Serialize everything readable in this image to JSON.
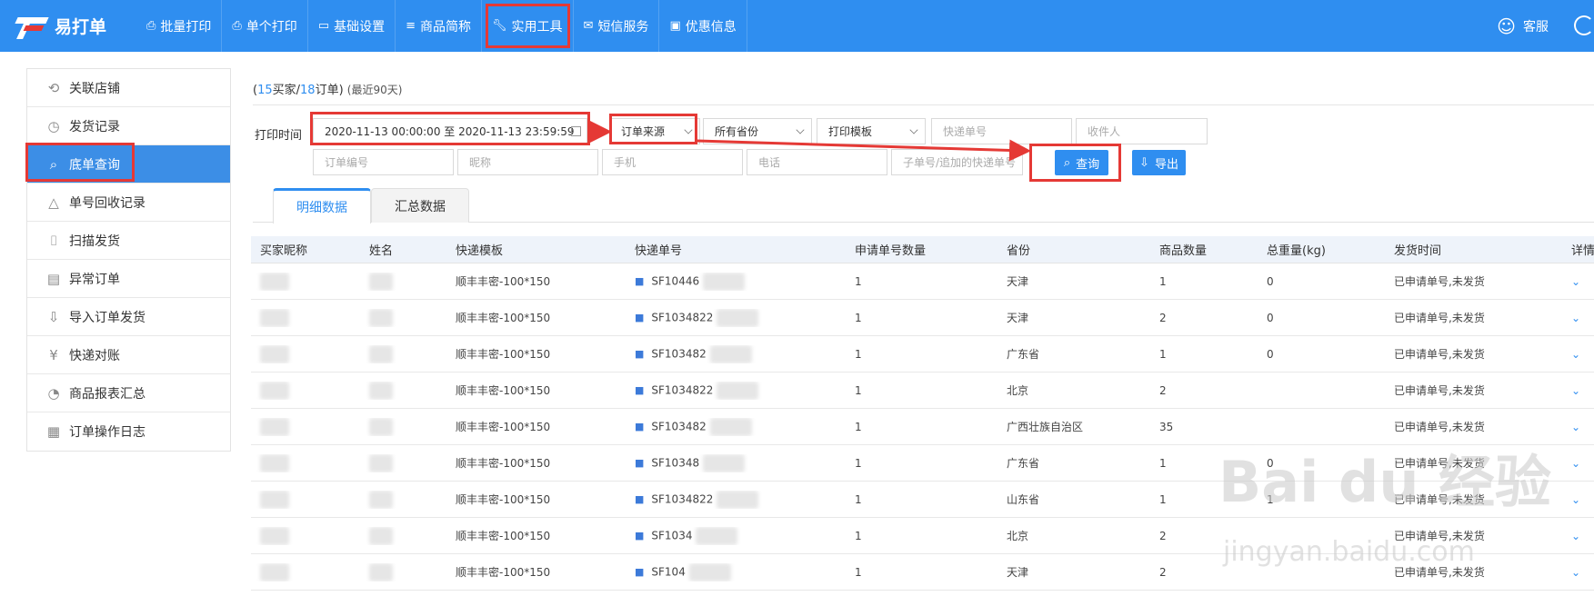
{
  "app": {
    "name": "易打单"
  },
  "nav": [
    {
      "icon": "printer-icon",
      "label": "批量打印"
    },
    {
      "icon": "printer-icon",
      "label": "单个打印"
    },
    {
      "icon": "monitor-icon",
      "label": "基础设置"
    },
    {
      "icon": "list-icon",
      "label": "商品简称"
    },
    {
      "icon": "wrench-icon",
      "label": "实用工具"
    },
    {
      "icon": "mail-icon",
      "label": "短信服务"
    },
    {
      "icon": "ticket-icon",
      "label": "优惠信息"
    }
  ],
  "header": {
    "service_label": "客服"
  },
  "sidebar": [
    {
      "icon": "link-icon",
      "label": "关联店铺"
    },
    {
      "icon": "clock-icon",
      "label": "发货记录"
    },
    {
      "icon": "search-icon",
      "label": "底单查询",
      "active": true
    },
    {
      "icon": "recycle-icon",
      "label": "单号回收记录"
    },
    {
      "icon": "scan-icon",
      "label": "扫描发货"
    },
    {
      "icon": "document-icon",
      "label": "异常订单"
    },
    {
      "icon": "import-icon",
      "label": "导入订单发货"
    },
    {
      "icon": "yuan-icon",
      "label": "快递对账"
    },
    {
      "icon": "pie-chart-icon",
      "label": "商品报表汇总"
    },
    {
      "icon": "calendar-icon",
      "label": "订单操作日志"
    }
  ],
  "summary": {
    "buyers": "15",
    "buyers_label": "买家/",
    "orders": "18",
    "orders_label": "订单)",
    "recent": "(最近90天)",
    "open": "("
  },
  "filters": {
    "print_time_label": "打印时间",
    "date_range": "2020-11-13 00:00:00 至 2020-11-13 23:59:59",
    "order_source": "订单来源",
    "province": "所有省份",
    "print_template": "打印模板",
    "express_no_placeholder": "快递单号",
    "receiver_placeholder": "收件人",
    "order_no_placeholder": "订单编号",
    "nickname_placeholder": "昵称",
    "mobile_placeholder": "手机",
    "phone_placeholder": "电话",
    "sub_no_placeholder": "子单号/追加的快递单号",
    "query_label": "查询",
    "export_label": "导出"
  },
  "tabs": [
    {
      "label": "明细数据",
      "active": true
    },
    {
      "label": "汇总数据"
    }
  ],
  "table": {
    "headers": [
      "买家昵称",
      "姓名",
      "快递模板",
      "快递单号",
      "申请单号数量",
      "省份",
      "商品数量",
      "总重量(kg)",
      "发货时间",
      "详情"
    ],
    "rows": [
      {
        "template": "顺丰丰密-100*150",
        "express": "SF10446",
        "qty": "1",
        "province": "天津",
        "goods": "1",
        "weight": "0",
        "status": "已申请单号,未发货"
      },
      {
        "template": "顺丰丰密-100*150",
        "express": "SF1034822",
        "qty": "1",
        "province": "天津",
        "goods": "2",
        "weight": "0",
        "status": "已申请单号,未发货"
      },
      {
        "template": "顺丰丰密-100*150",
        "express": "SF103482",
        "qty": "1",
        "province": "广东省",
        "goods": "1",
        "weight": "0",
        "status": "已申请单号,未发货"
      },
      {
        "template": "顺丰丰密-100*150",
        "express": "SF1034822",
        "qty": "1",
        "province": "北京",
        "goods": "2",
        "weight": "",
        "status": "已申请单号,未发货"
      },
      {
        "template": "顺丰丰密-100*150",
        "express": "SF103482",
        "qty": "1",
        "province": "广西壮族自治区",
        "goods": "35",
        "weight": "",
        "status": "已申请单号,未发货"
      },
      {
        "template": "顺丰丰密-100*150",
        "express": "SF10348",
        "qty": "1",
        "province": "广东省",
        "goods": "1",
        "weight": "0",
        "status": "已申请单号,未发货"
      },
      {
        "template": "顺丰丰密-100*150",
        "express": "SF1034822",
        "qty": "1",
        "province": "山东省",
        "goods": "1",
        "weight": "1",
        "status": "已申请单号,未发货"
      },
      {
        "template": "顺丰丰密-100*150",
        "express": "SF1034",
        "qty": "1",
        "province": "北京",
        "goods": "2",
        "weight": "",
        "status": "已申请单号,未发货"
      },
      {
        "template": "顺丰丰密-100*150",
        "express": "SF104",
        "qty": "1",
        "province": "天津",
        "goods": "2",
        "weight": "",
        "status": "已申请单号,未发货"
      }
    ]
  },
  "watermark": {
    "brand": "Bai du 经验",
    "url": "jingyan.baidu.com"
  },
  "colors": {
    "primary": "#2f8ef0",
    "highlight": "#e53935"
  }
}
